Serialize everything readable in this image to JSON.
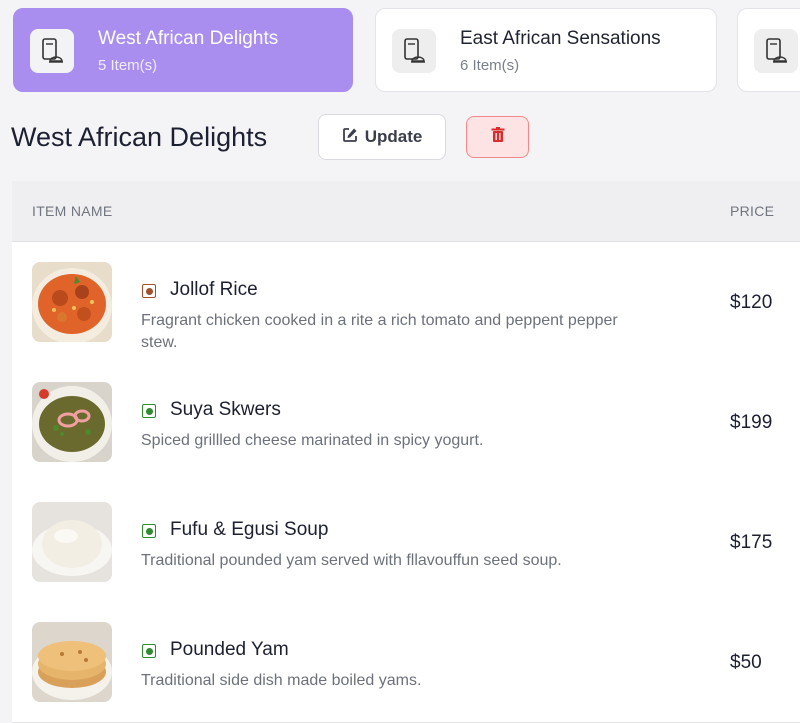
{
  "categories": [
    {
      "name": "West African Delights",
      "count": "5 Item(s)",
      "active": true
    },
    {
      "name": "East African Sensations",
      "count": "6 Item(s)",
      "active": false
    },
    {
      "name": "",
      "count": "",
      "active": false
    }
  ],
  "section": {
    "title": "West African Delights",
    "update_label": "Update",
    "update_icon": "edit-icon",
    "delete_icon": "trash-icon"
  },
  "table": {
    "headers": {
      "name": "ITEM NAME",
      "price": "PRICE"
    },
    "items": [
      {
        "name": "Jollof Rice",
        "desc": "Fragrant chicken cooked in a rite a rich tomato and peppent pepper stew.",
        "price": "$120",
        "indicator_color": "#a0502a",
        "thumb": "jollof-rice"
      },
      {
        "name": "Suya Skwers",
        "desc": "Spiced grillled cheese marinated in spicy yogurt.",
        "price": "$199",
        "indicator_color": "#2e8b2e",
        "thumb": "suya-skewers"
      },
      {
        "name": "Fufu & Egusi Soup",
        "desc": "Traditional pounded yam served with fllavouffun seed soup.",
        "price": "$175",
        "indicator_color": "#2e8b2e",
        "thumb": "fufu-egusi"
      },
      {
        "name": "Pounded Yam",
        "desc": "Traditional side dish made boiled yams.",
        "price": "$50",
        "indicator_color": "#2e8b2e",
        "thumb": "pounded-yam"
      }
    ]
  },
  "colors": {
    "accent": "#a98ef0",
    "danger": "#e05050",
    "veg": "#2e8b2e"
  }
}
